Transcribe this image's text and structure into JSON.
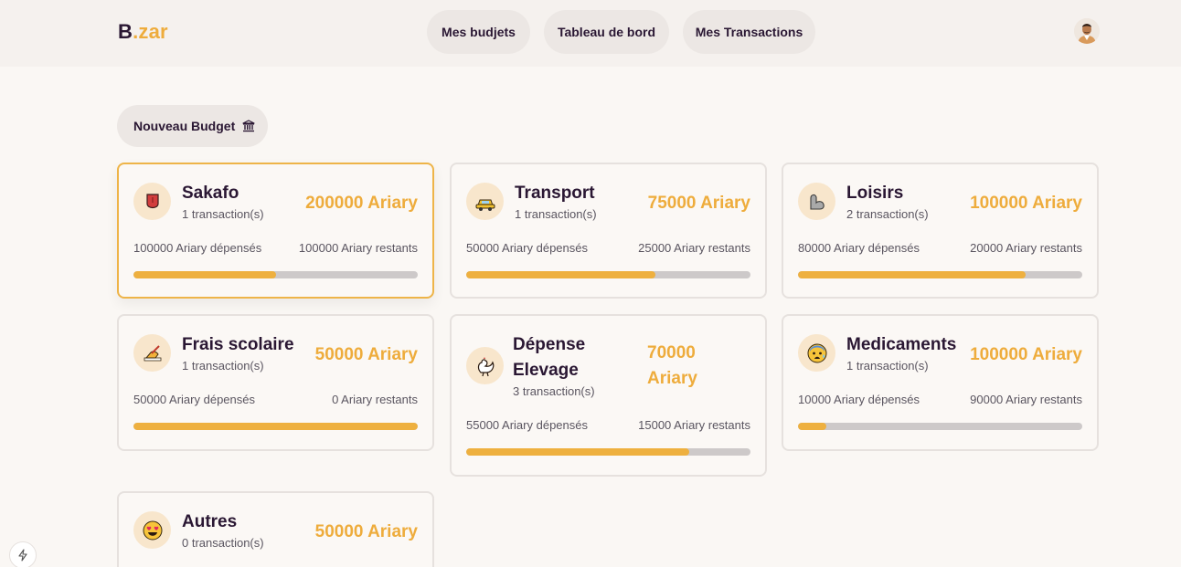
{
  "header": {
    "logo_b": "B",
    "logo_rest": ".zar",
    "nav": [
      {
        "label": "Mes budjets"
      },
      {
        "label": "Tableau de bord"
      },
      {
        "label": "Mes Transactions"
      }
    ]
  },
  "new_budget_label": "Nouveau Budget",
  "budgets": [
    {
      "name": "Sakafo",
      "transactions": "1 transaction(s)",
      "amount": "200000 Ariary",
      "spent": "100000 Ariary dépensés",
      "remaining": "100000 Ariary restants",
      "progress": 0.5,
      "icon": "tongue-emoji-icon"
    },
    {
      "name": "Transport",
      "transactions": "1 transaction(s)",
      "amount": "75000 Ariary",
      "spent": "50000 Ariary dépensés",
      "remaining": "25000 Ariary restants",
      "progress": 0.667,
      "icon": "taxi-emoji-icon"
    },
    {
      "name": "Loisirs",
      "transactions": "2 transaction(s)",
      "amount": "100000 Ariary",
      "spent": "80000 Ariary dépensés",
      "remaining": "20000 Ariary restants",
      "progress": 0.8,
      "icon": "flexed-arm-emoji-icon"
    },
    {
      "name": "Frais scolaire",
      "transactions": "1 transaction(s)",
      "amount": "50000 Ariary",
      "spent": "50000 Ariary dépensés",
      "remaining": "0 Ariary restants",
      "progress": 1.0,
      "icon": "writing-hand-emoji-icon"
    },
    {
      "name_line1": "Dépense",
      "name_line2": "Elevage",
      "transactions": "3 transaction(s)",
      "amount_line1": "70000",
      "amount_line2": "Ariary",
      "spent": "55000 Ariary dépensés",
      "remaining": "15000 Ariary restants",
      "progress": 0.786,
      "icon": "rooster-emoji-icon"
    },
    {
      "name": "Medicaments",
      "transactions": "1 transaction(s)",
      "amount": "100000 Ariary",
      "spent": "10000 Ariary dépensés",
      "remaining": "90000 Ariary restants",
      "progress": 0.1,
      "icon": "anxious-face-emoji-icon"
    },
    {
      "name": "Autres",
      "transactions": "0 transaction(s)",
      "amount": "50000 Ariary",
      "icon": "heart-eyes-emoji-icon"
    }
  ],
  "colors": {
    "accent": "#eeac3c",
    "text": "#2a1733",
    "track": "#cdc9c9"
  }
}
